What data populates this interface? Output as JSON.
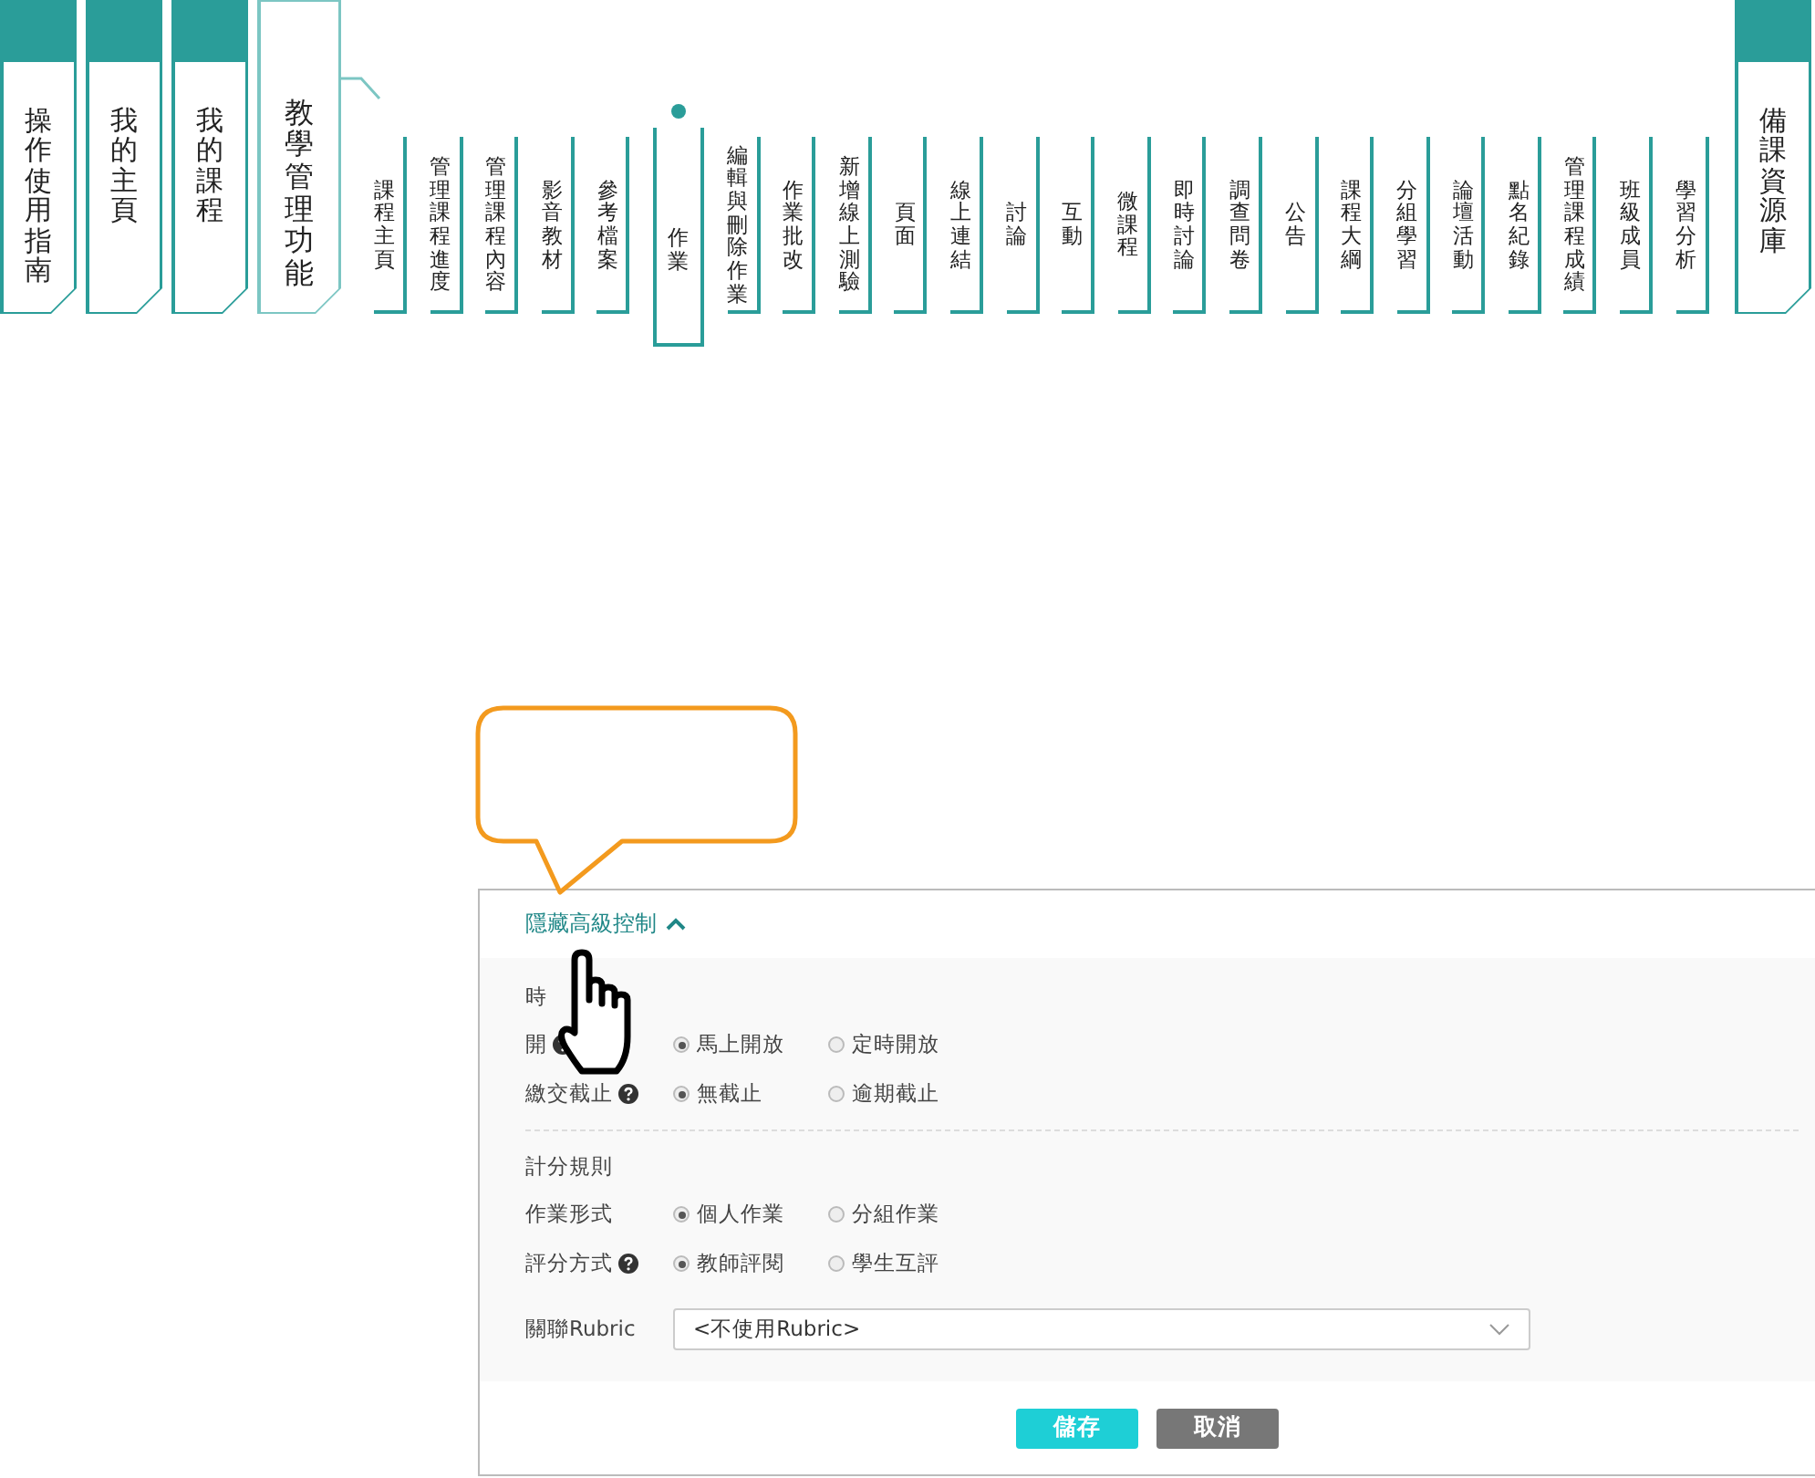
{
  "nav": {
    "main_tabs": [
      {
        "label": "操作使用指南",
        "selected": false
      },
      {
        "label": "我的主頁",
        "selected": false
      },
      {
        "label": "我的課程",
        "selected": false
      },
      {
        "label": "教學管理功能",
        "selected": true
      }
    ],
    "sub_tabs": [
      {
        "label": "課程主頁",
        "selected": false
      },
      {
        "label": "管理課程進度",
        "selected": false
      },
      {
        "label": "管理課程內容",
        "selected": false
      },
      {
        "label": "影音教材",
        "selected": false
      },
      {
        "label": "參考檔案",
        "selected": false
      },
      {
        "label": "作業",
        "selected": true
      },
      {
        "label": "編輯與刪除作業",
        "selected": false
      },
      {
        "label": "作業批改",
        "selected": false
      },
      {
        "label": "新增線上測驗",
        "selected": false
      },
      {
        "label": "頁面",
        "selected": false
      },
      {
        "label": "線上連結",
        "selected": false
      },
      {
        "label": "討論",
        "selected": false
      },
      {
        "label": "互動",
        "selected": false
      },
      {
        "label": "微課程",
        "selected": false
      },
      {
        "label": "即時討論",
        "selected": false
      },
      {
        "label": "調查問卷",
        "selected": false
      },
      {
        "label": "公告",
        "selected": false
      },
      {
        "label": "課程大綱",
        "selected": false
      },
      {
        "label": "分組學習",
        "selected": false
      },
      {
        "label": "論壇活動",
        "selected": false
      },
      {
        "label": "點名紀錄",
        "selected": false
      },
      {
        "label": "管理課程成績",
        "selected": false
      },
      {
        "label": "班級成員",
        "selected": false
      },
      {
        "label": "學習分析",
        "selected": false
      }
    ],
    "resource_tab": {
      "label": "備課資源庫",
      "selected": false
    }
  },
  "panel": {
    "toggle": {
      "label": "隱藏高級控制",
      "expanded": true
    },
    "sections": [
      {
        "title": "時",
        "rows": [
          {
            "label": "開",
            "help": true,
            "options": [
              {
                "label": "馬上開放",
                "selected": true
              },
              {
                "label": "定時開放",
                "selected": false
              }
            ]
          },
          {
            "label": "繳交截止",
            "help": true,
            "options": [
              {
                "label": "無截止",
                "selected": true
              },
              {
                "label": "逾期截止",
                "selected": false
              }
            ]
          }
        ]
      },
      {
        "title": "計分規則",
        "rows": [
          {
            "label": "作業形式",
            "help": false,
            "options": [
              {
                "label": "個人作業",
                "selected": true
              },
              {
                "label": "分組作業",
                "selected": false
              }
            ]
          },
          {
            "label": "評分方式",
            "help": true,
            "options": [
              {
                "label": "教師評閱",
                "selected": true
              },
              {
                "label": "學生互評",
                "selected": false
              }
            ]
          }
        ]
      }
    ],
    "rubric": {
      "label": "關聯Rubric",
      "value": "<不使用Rubric>"
    },
    "buttons": [
      {
        "label": "儲存",
        "kind": "primary"
      },
      {
        "label": "取消",
        "kind": "secondary"
      }
    ]
  }
}
